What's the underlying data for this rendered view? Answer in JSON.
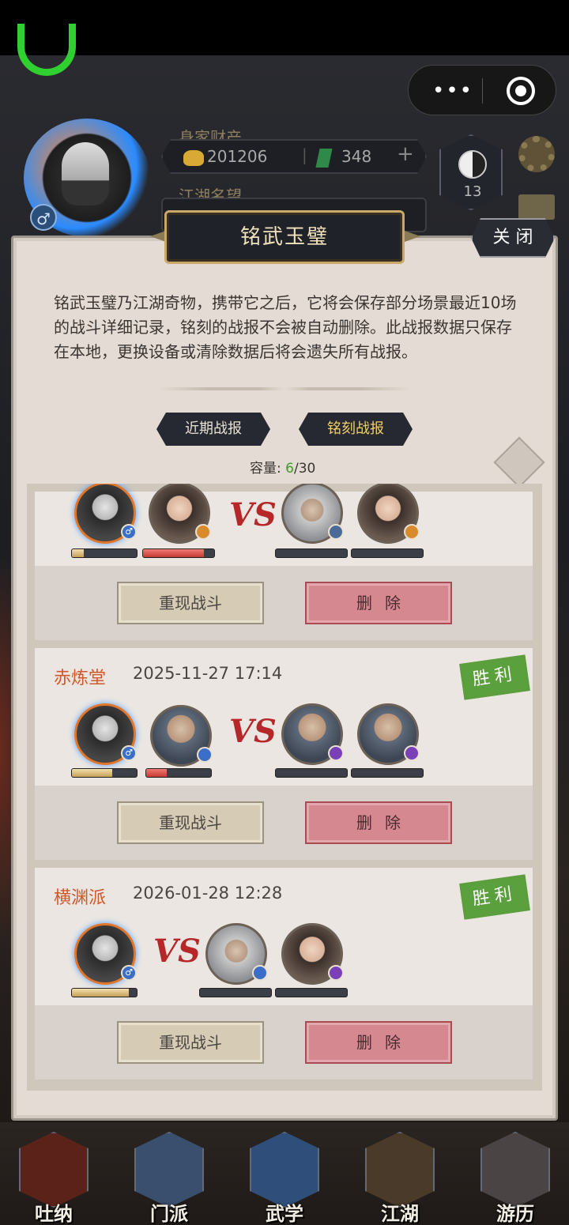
{
  "status_bar": {},
  "capsule": {
    "more": "•••"
  },
  "profile": {
    "wealth_label": "身家财产",
    "gold": "201206",
    "jade": "348",
    "plus": "+",
    "reputation_label": "江湖名望",
    "level": "13",
    "gender": "♂"
  },
  "panel": {
    "title": "铭武玉璧",
    "close": "关 闭",
    "description": "铭武玉璧乃江湖奇物，携带它之后，它将会保存部分场景最近10场的战斗详细记录，铭刻的战报不会被自动删除。此战报数据只保存在本地，更换设备或清除数据后将会遗失所有战报。",
    "tabs": [
      {
        "label": "近期战报",
        "active": false
      },
      {
        "label": "铭刻战报",
        "active": true
      }
    ],
    "capacity_label": "容量:",
    "capacity_used": "6",
    "capacity_total": "/30"
  },
  "records": [
    {
      "pavilion": "",
      "time": "",
      "result": "",
      "left_hp": [
        0.18,
        0.85
      ],
      "right_hp": [
        0,
        0
      ],
      "replay": "重现战斗",
      "delete": "删除"
    },
    {
      "pavilion": "赤炼堂",
      "time": "2025-11-27 17:14",
      "result": "胜利",
      "left_hp": [
        0.62,
        0.32
      ],
      "right_hp": [
        0,
        0
      ],
      "replay": "重现战斗",
      "delete": "删除"
    },
    {
      "pavilion": "横渊派",
      "time": "2026-01-28 12:28",
      "result": "胜利",
      "left_hp": [
        0.88
      ],
      "right_hp": [
        0,
        0
      ],
      "replay": "重现战斗",
      "delete": "删除"
    }
  ],
  "vs_text": "VS",
  "bottom_nav": [
    {
      "label": "吐纳"
    },
    {
      "label": "门派"
    },
    {
      "label": "武学"
    },
    {
      "label": "江湖"
    },
    {
      "label": "游历"
    }
  ],
  "colors": {
    "accent_gold": "#f0cf6c",
    "pavilion": "#d1582b",
    "win": "#5aa03c",
    "delete": "#d68891"
  }
}
